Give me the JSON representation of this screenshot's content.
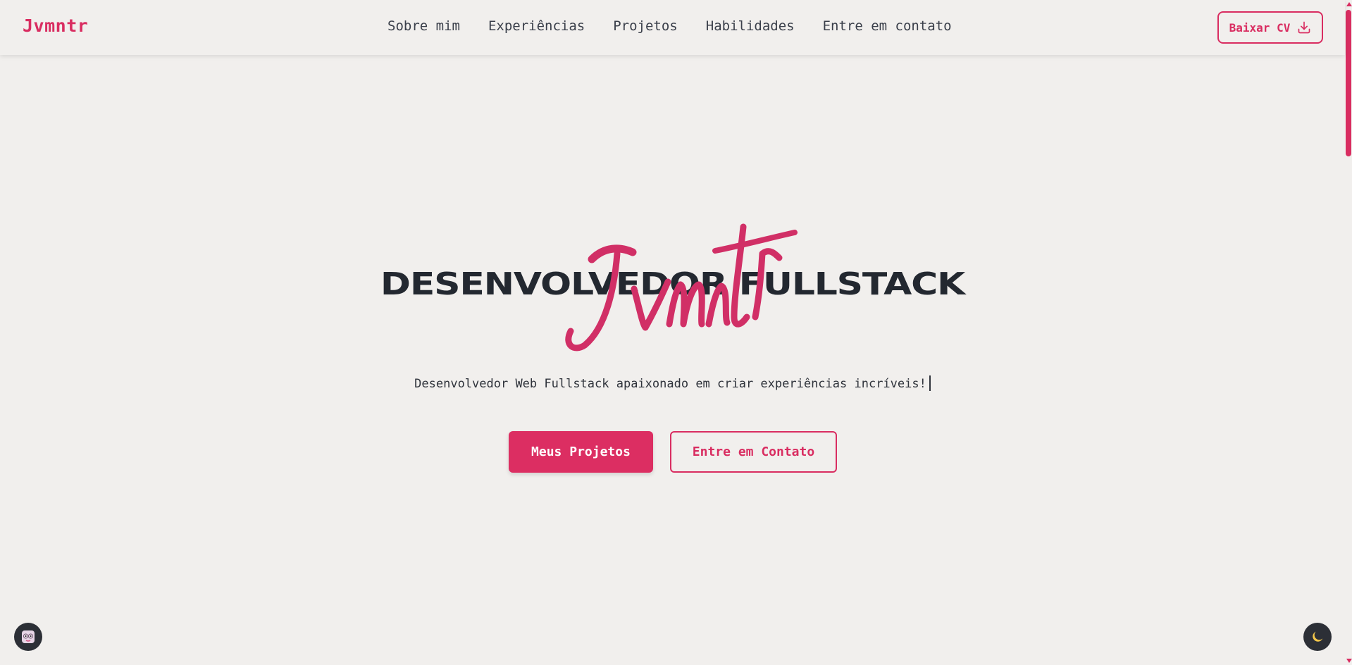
{
  "header": {
    "logo": "Jvmntr",
    "nav": [
      "Sobre mim",
      "Experiências",
      "Projetos",
      "Habilidades",
      "Entre em contato"
    ],
    "cv_button": "Baixar CV",
    "cv_icon": "download-icon"
  },
  "hero": {
    "title": "DESENVOLVEDOR FULLSTACK",
    "signature": "Jvmntr",
    "subtitle": "Desenvolvedor Web Fullstack apaixonado em criar experiências incríveis!",
    "primary_button": "Meus Projetos",
    "secondary_button": "Entre em Contato"
  },
  "floating": {
    "left_icon": "avatar-icon",
    "right_icon": "moon-icon"
  },
  "colors": {
    "accent": "#d92d61",
    "background": "#f1efed",
    "text": "#232830"
  }
}
